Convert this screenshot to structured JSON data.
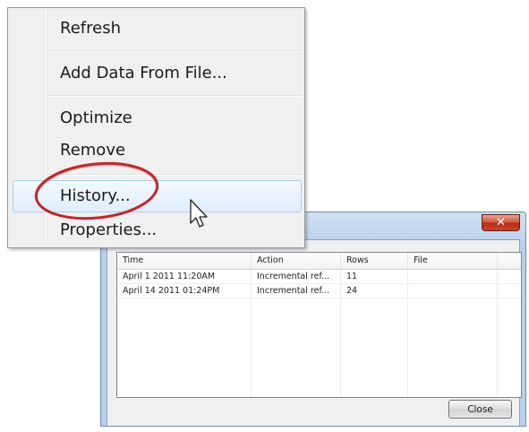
{
  "menu": {
    "items": [
      {
        "label": "Refresh"
      },
      {
        "label": "Add Data From File..."
      },
      {
        "label": "Optimize"
      },
      {
        "label": "Remove"
      },
      {
        "label": "History..."
      },
      {
        "label": "Properties..."
      }
    ],
    "highlighted": "History..."
  },
  "dialog": {
    "close_glyph": "✕",
    "table": {
      "columns": [
        "Time",
        "Action",
        "Rows",
        "File"
      ],
      "rows": [
        {
          "time": "April 1 2011 11:20AM",
          "action": "Incremental ref...",
          "rows": "11",
          "file": ""
        },
        {
          "time": "April 14 2011 01:24PM",
          "action": "Incremental ref...",
          "rows": "24",
          "file": ""
        }
      ]
    },
    "close_button_label": "Close"
  },
  "colors": {
    "annotation": "#c1272d",
    "highlight_border": "#a8d0f5",
    "close_button_red": "#c8462c"
  },
  "icons": {
    "cursor": "mouse-pointer-icon",
    "window_close": "close-icon"
  }
}
